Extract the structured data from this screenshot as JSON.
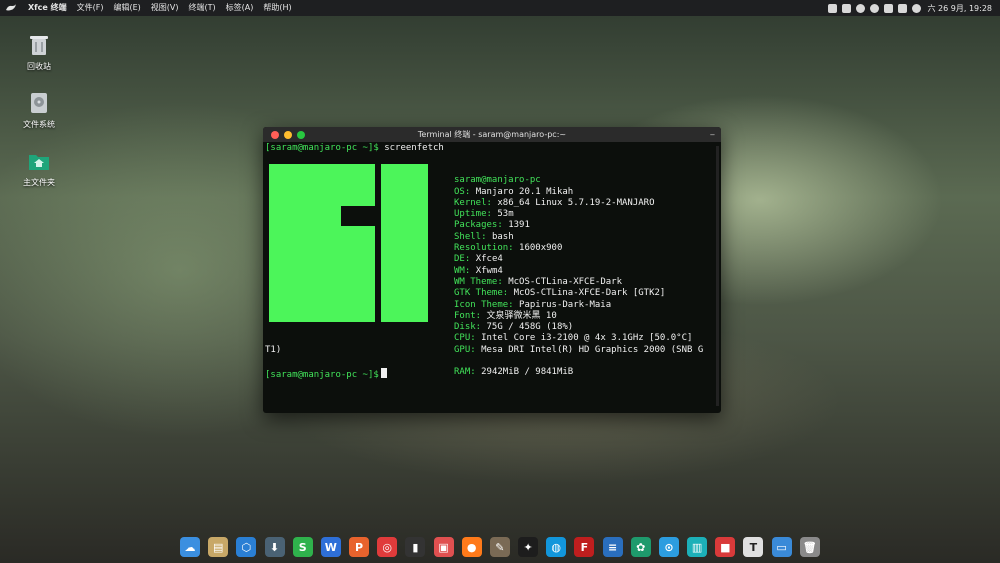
{
  "top_panel": {
    "menu": [
      "Xfce 终端",
      "文件(F)",
      "编辑(E)",
      "视图(V)",
      "终端(T)",
      "标签(A)",
      "帮助(H)"
    ],
    "clock": "六 26 9月, 19:28"
  },
  "desktop": {
    "icons": [
      {
        "label": "回收站",
        "icon": "trash-icon"
      },
      {
        "label": "文件系统",
        "icon": "drive-icon"
      },
      {
        "label": "主文件夹",
        "icon": "home-folder-icon"
      }
    ]
  },
  "terminal": {
    "title": "Terminal 终端 - saram@manjaro-pc:~",
    "prompt": "[saram@manjaro-pc ~]$",
    "command": "screenfetch",
    "wrap_tail": "T1)",
    "user_host": "saram@manjaro-pc",
    "info": [
      {
        "key": "OS:",
        "value": "Manjaro 20.1 Mikah"
      },
      {
        "key": "Kernel:",
        "value": "x86_64 Linux 5.7.19-2-MANJARO"
      },
      {
        "key": "Uptime:",
        "value": "53m"
      },
      {
        "key": "Packages:",
        "value": "1391"
      },
      {
        "key": "Shell:",
        "value": "bash"
      },
      {
        "key": "Resolution:",
        "value": "1600x900"
      },
      {
        "key": "DE:",
        "value": "Xfce4"
      },
      {
        "key": "WM:",
        "value": "Xfwm4"
      },
      {
        "key": "WM Theme:",
        "value": "McOS-CTLina-XFCE-Dark"
      },
      {
        "key": "GTK Theme:",
        "value": "McOS-CTLina-XFCE-Dark [GTK2]"
      },
      {
        "key": "Icon Theme:",
        "value": "Papirus-Dark-Maia"
      },
      {
        "key": "Font:",
        "value": "文泉驿微米黑 10"
      },
      {
        "key": "Disk:",
        "value": "75G / 458G (18%)"
      },
      {
        "key": "CPU:",
        "value": "Intel Core i3-2100 @ 4x 3.1GHz [50.0°C]"
      },
      {
        "key": "GPU:",
        "value": "Mesa DRI Intel(R) HD Graphics 2000 (SNB G"
      },
      {
        "key": "",
        "value": ""
      },
      {
        "key": "RAM:",
        "value": "2942MiB / 9841MiB"
      }
    ],
    "colors": {
      "prompt": "#42e35a",
      "logo": "#4cf55a",
      "background": "#0c0f0c"
    }
  },
  "dock": {
    "icons": [
      {
        "name": "cloud-app-icon",
        "color": "#3b8fe0",
        "glyph": "☁"
      },
      {
        "name": "files-icon",
        "color": "#c8a867",
        "glyph": "▤"
      },
      {
        "name": "network-icon",
        "color": "#2a7fd4",
        "glyph": "⬡"
      },
      {
        "name": "download-icon",
        "color": "#4a6274",
        "glyph": "⬇"
      },
      {
        "name": "wps-spreadsheet-icon",
        "color": "#2fb24c",
        "glyph": "S"
      },
      {
        "name": "wps-writer-icon",
        "color": "#2e6fd8",
        "glyph": "W"
      },
      {
        "name": "wps-presentation-icon",
        "color": "#e8632d",
        "glyph": "P"
      },
      {
        "name": "netease-music-icon",
        "color": "#e03b3b",
        "glyph": "◎"
      },
      {
        "name": "terminal-icon",
        "color": "#333333",
        "glyph": "▮"
      },
      {
        "name": "screenshot-icon",
        "color": "#e05050",
        "glyph": "▣"
      },
      {
        "name": "firefox-icon",
        "color": "#ff7a1a",
        "glyph": "●"
      },
      {
        "name": "gimp-icon",
        "color": "#7a6a55",
        "glyph": "✎"
      },
      {
        "name": "qq-icon",
        "color": "#1d1d1d",
        "glyph": "✦"
      },
      {
        "name": "qq-chat-icon",
        "color": "#1296db",
        "glyph": "◍"
      },
      {
        "name": "filezilla-icon",
        "color": "#bf1e1e",
        "glyph": "F"
      },
      {
        "name": "editor-icon",
        "color": "#2a6ebd",
        "glyph": "≡"
      },
      {
        "name": "settings-icon",
        "color": "#1e9a6c",
        "glyph": "✿"
      },
      {
        "name": "baidu-netdisk-icon",
        "color": "#2c9de0",
        "glyph": "⊙"
      },
      {
        "name": "reader-icon",
        "color": "#1cb0b8",
        "glyph": "▥"
      },
      {
        "name": "recorder-icon",
        "color": "#d93a3a",
        "glyph": "■"
      },
      {
        "name": "text-editor-icon",
        "color": "#e0e0e0",
        "glyph": "T"
      },
      {
        "name": "desktop-icon",
        "color": "#3a8ad8",
        "glyph": "▭"
      },
      {
        "name": "trash-dock-icon",
        "color": "#8a8a8a",
        "glyph": "🗑"
      }
    ]
  }
}
